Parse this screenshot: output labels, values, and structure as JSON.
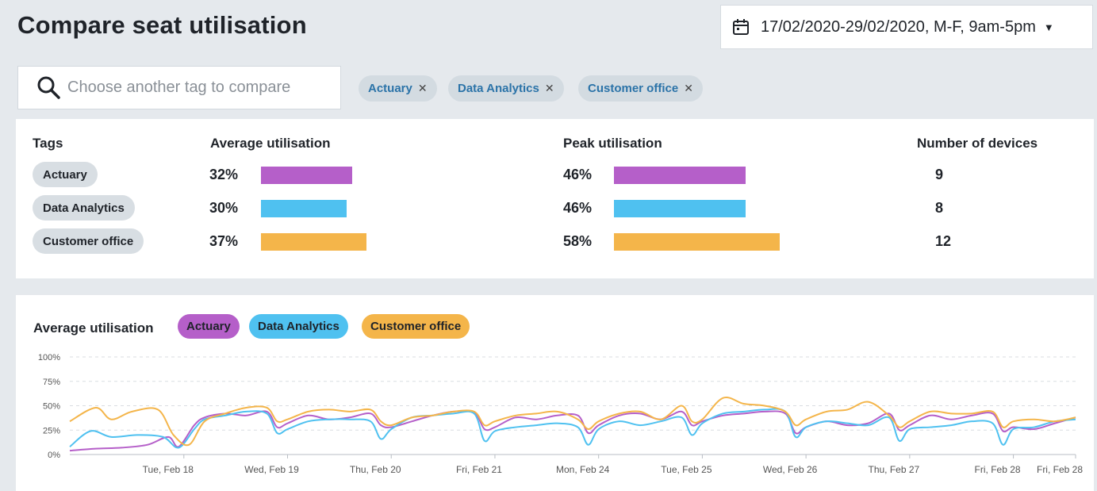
{
  "header": {
    "title": "Compare seat utilisation",
    "date_range": "17/02/2020-29/02/2020, M-F, 9am-5pm"
  },
  "search": {
    "placeholder": "Choose another tag to compare"
  },
  "selected_tags": [
    {
      "label": "Actuary"
    },
    {
      "label": "Data Analytics"
    },
    {
      "label": "Customer office"
    }
  ],
  "summary": {
    "headers": {
      "tags": "Tags",
      "average": "Average utilisation",
      "peak": "Peak utilisation",
      "devices": "Number of devices"
    },
    "rows": [
      {
        "tag": "Actuary",
        "average": "32%",
        "average_value": 32,
        "peak": "46%",
        "peak_value": 46,
        "devices": "9",
        "color": "#b55fc9"
      },
      {
        "tag": "Data Analytics",
        "average": "30%",
        "average_value": 30,
        "peak": "46%",
        "peak_value": 46,
        "devices": "8",
        "color": "#4fc1f0"
      },
      {
        "tag": "Customer office",
        "average": "37%",
        "average_value": 37,
        "peak": "58%",
        "peak_value": 58,
        "devices": "12",
        "color": "#f4b54a"
      }
    ]
  },
  "chart_data": {
    "type": "line",
    "title": "Average utilisation",
    "ylim": [
      0,
      100
    ],
    "yticks": [
      "100%",
      "75%",
      "50%",
      "25%",
      "0%"
    ],
    "ytick_values": [
      100,
      75,
      50,
      25,
      0
    ],
    "xticks": [
      "Tue, Feb 18",
      "Wed, Feb 19",
      "Thu, Feb 20",
      "Fri, Feb 21",
      "Mon, Feb 24",
      "Tue, Feb 25",
      "Wed, Feb 26",
      "Thu, Feb 27",
      "Fri, Feb 28",
      "Fri, Feb 28"
    ],
    "xtick_positions": [
      1,
      2,
      3,
      4,
      5,
      6,
      7,
      8,
      9,
      9.6
    ],
    "xrange": [
      -0.1,
      9.6
    ],
    "grid": true,
    "legend": "top-left",
    "series": [
      {
        "name": "Actuary",
        "color": "#b55fc9",
        "x": [
          -0.1,
          0.15,
          0.4,
          0.65,
          0.85,
          0.95,
          1.1,
          1.2,
          1.4,
          1.6,
          1.8,
          1.9,
          2.0,
          2.2,
          2.4,
          2.6,
          2.8,
          2.9,
          3.0,
          3.2,
          3.4,
          3.6,
          3.8,
          3.9,
          4.0,
          4.2,
          4.4,
          4.6,
          4.8,
          4.9,
          5.0,
          5.2,
          5.4,
          5.6,
          5.8,
          5.9,
          6.0,
          6.2,
          6.4,
          6.6,
          6.8,
          6.9,
          7.0,
          7.2,
          7.4,
          7.6,
          7.8,
          7.9,
          8.0,
          8.2,
          8.4,
          8.6,
          8.8,
          8.9,
          9.0,
          9.2,
          9.4,
          9.6
        ],
        "y": [
          4,
          6,
          7,
          10,
          18,
          8,
          30,
          38,
          42,
          40,
          44,
          28,
          32,
          40,
          36,
          38,
          42,
          30,
          28,
          34,
          40,
          44,
          43,
          26,
          28,
          38,
          36,
          40,
          40,
          22,
          30,
          40,
          42,
          36,
          44,
          30,
          34,
          40,
          42,
          44,
          42,
          22,
          28,
          34,
          30,
          32,
          42,
          25,
          30,
          40,
          36,
          40,
          42,
          24,
          28,
          26,
          32,
          38
        ]
      },
      {
        "name": "Data Analytics",
        "color": "#4fc1f0",
        "x": [
          -0.1,
          0.1,
          0.3,
          0.55,
          0.8,
          0.95,
          1.1,
          1.2,
          1.4,
          1.6,
          1.8,
          1.9,
          2.0,
          2.2,
          2.4,
          2.6,
          2.8,
          2.9,
          3.0,
          3.2,
          3.4,
          3.6,
          3.8,
          3.9,
          4.0,
          4.2,
          4.4,
          4.6,
          4.8,
          4.9,
          5.0,
          5.2,
          5.4,
          5.6,
          5.8,
          5.9,
          6.0,
          6.2,
          6.4,
          6.6,
          6.8,
          6.9,
          7.0,
          7.2,
          7.4,
          7.6,
          7.8,
          7.9,
          8.0,
          8.2,
          8.4,
          8.6,
          8.8,
          8.9,
          9.0,
          9.2,
          9.4,
          9.6
        ],
        "y": [
          8,
          24,
          18,
          20,
          18,
          7,
          26,
          36,
          40,
          44,
          42,
          22,
          26,
          34,
          36,
          36,
          34,
          16,
          26,
          38,
          40,
          42,
          42,
          14,
          24,
          28,
          30,
          32,
          28,
          10,
          26,
          34,
          30,
          34,
          38,
          20,
          32,
          42,
          44,
          46,
          44,
          18,
          28,
          34,
          32,
          30,
          38,
          14,
          26,
          28,
          30,
          34,
          32,
          10,
          26,
          28,
          34,
          36
        ]
      },
      {
        "name": "Customer office",
        "color": "#f4b54a",
        "x": [
          -0.1,
          0.15,
          0.3,
          0.5,
          0.75,
          0.9,
          1.05,
          1.2,
          1.4,
          1.6,
          1.8,
          1.9,
          2.0,
          2.2,
          2.4,
          2.6,
          2.8,
          2.9,
          3.0,
          3.2,
          3.4,
          3.6,
          3.8,
          3.9,
          4.0,
          4.2,
          4.4,
          4.6,
          4.8,
          4.9,
          5.0,
          5.2,
          5.4,
          5.6,
          5.8,
          5.9,
          6.0,
          6.2,
          6.4,
          6.6,
          6.8,
          6.9,
          7.0,
          7.2,
          7.4,
          7.6,
          7.8,
          7.9,
          8.0,
          8.2,
          8.4,
          8.6,
          8.8,
          8.9,
          9.0,
          9.2,
          9.4,
          9.6
        ],
        "y": [
          34,
          48,
          36,
          44,
          46,
          20,
          10,
          34,
          42,
          48,
          48,
          34,
          36,
          44,
          46,
          44,
          46,
          34,
          30,
          38,
          40,
          44,
          44,
          30,
          34,
          40,
          42,
          44,
          36,
          26,
          34,
          42,
          44,
          36,
          50,
          34,
          36,
          58,
          52,
          50,
          44,
          30,
          36,
          44,
          46,
          54,
          40,
          28,
          34,
          44,
          42,
          42,
          44,
          28,
          34,
          36,
          34,
          38
        ]
      }
    ]
  }
}
